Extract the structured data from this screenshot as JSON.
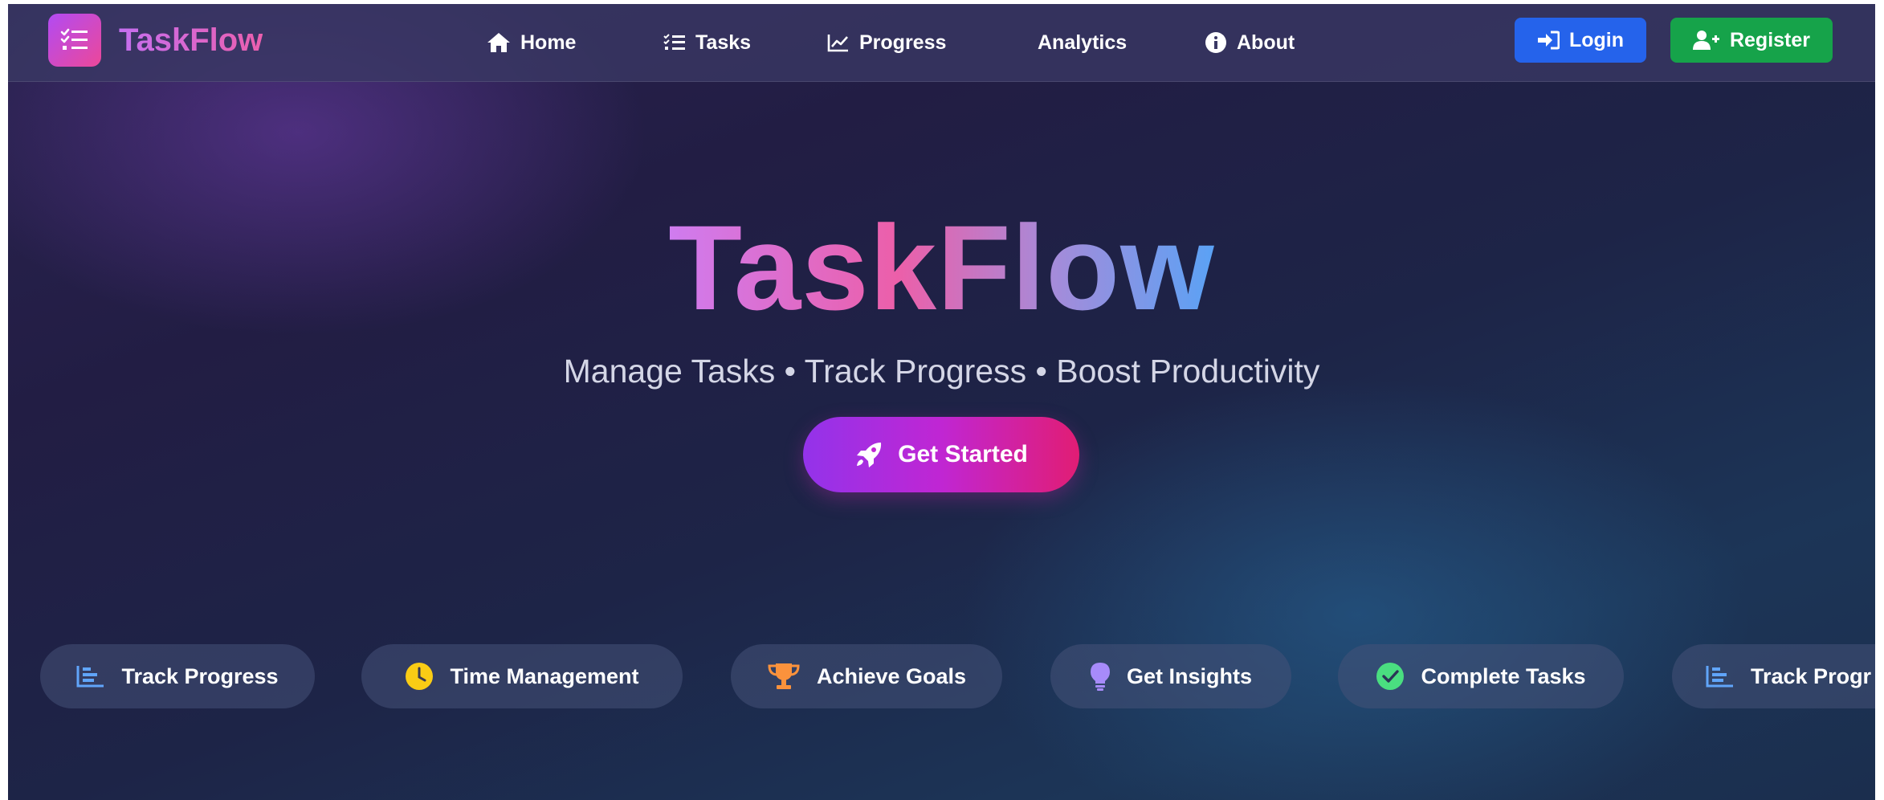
{
  "navbar": {
    "brand_name": "TaskFlow",
    "brand_icon": "tasks-list-icon",
    "links": [
      {
        "label": "Home",
        "icon": "home-icon"
      },
      {
        "label": "Tasks",
        "icon": "tasks-list-icon"
      },
      {
        "label": "Progress",
        "icon": "line-chart-icon"
      },
      {
        "label": "Analytics",
        "icon": ""
      },
      {
        "label": "About",
        "icon": "info-icon"
      }
    ],
    "login_label": "Login",
    "register_label": "Register"
  },
  "hero": {
    "title": "TaskFlow",
    "subtitle": "Manage Tasks • Track Progress • Boost Productivity",
    "cta_label": "Get Started",
    "cta_icon": "rocket-icon"
  },
  "features": [
    {
      "label": "Track Progress",
      "icon": "bar-chart-icon",
      "color": "#60a5fa"
    },
    {
      "label": "Time Management",
      "icon": "clock-icon",
      "color": "#facc15"
    },
    {
      "label": "Achieve Goals",
      "icon": "trophy-icon",
      "color": "#fb923c"
    },
    {
      "label": "Get Insights",
      "icon": "lightbulb-icon",
      "color": "#a78bfa"
    },
    {
      "label": "Complete Tasks",
      "icon": "check-circle-icon",
      "color": "#4ade80"
    },
    {
      "label": "Track Progr",
      "icon": "bar-chart-icon",
      "color": "#60a5fa"
    }
  ],
  "colors": {
    "login": "#2563eb",
    "register": "#16a34a",
    "cta_start": "#9333ea",
    "cta_end": "#e11d74"
  }
}
